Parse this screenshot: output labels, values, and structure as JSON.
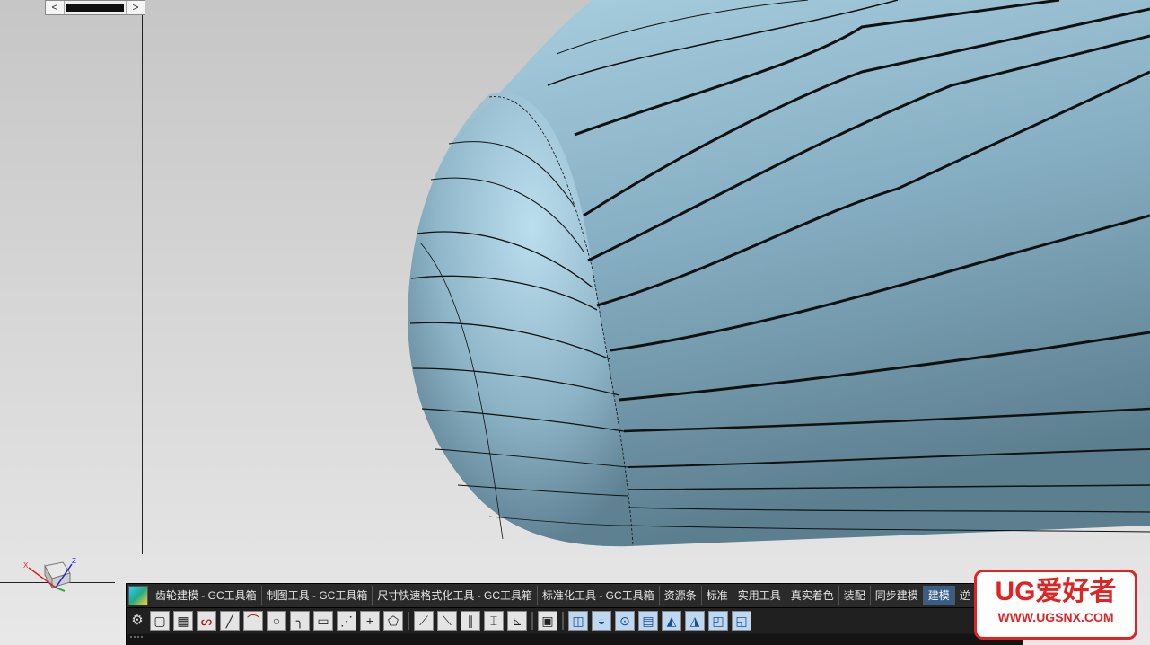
{
  "viewport": {
    "background_top": "#c8c8c8",
    "background_bottom": "#e6e6e6",
    "model_color": "#7fa9bd",
    "triad_labels": {
      "x": "X",
      "y": "Y",
      "z": "Z"
    }
  },
  "scrollbar": {
    "left_arrow": "<",
    "right_arrow": ">"
  },
  "toolbar": {
    "tabs": [
      {
        "label": "齿轮建模 - GC工具箱"
      },
      {
        "label": "制图工具 - GC工具箱"
      },
      {
        "label": "尺寸快速格式化工具 - GC工具箱"
      },
      {
        "label": "标准化工具 - GC工具箱"
      },
      {
        "label": "资源条"
      },
      {
        "label": "标准"
      },
      {
        "label": "实用工具"
      },
      {
        "label": "真实着色"
      },
      {
        "label": "装配"
      },
      {
        "label": "同步建模"
      },
      {
        "label": "建模"
      },
      {
        "label": "逆"
      }
    ],
    "active_tab": "建模",
    "settings_icon": "gear-icon",
    "overflow_label": "»",
    "tools": [
      {
        "name": "rectangle-tool-icon",
        "glyph": "▢"
      },
      {
        "name": "pattern-tool-icon",
        "glyph": "▦"
      },
      {
        "name": "spline-tool-icon",
        "glyph": "ᔕ"
      },
      {
        "name": "line-tool-icon",
        "glyph": "╱"
      },
      {
        "name": "arc-tool-icon",
        "glyph": "⌒"
      },
      {
        "name": "circle-tool-icon",
        "glyph": "○"
      },
      {
        "name": "fillet-tool-icon",
        "glyph": "╮"
      },
      {
        "name": "rectangle2-tool-icon",
        "glyph": "▭"
      },
      {
        "name": "polyline-tool-icon",
        "glyph": "⋰"
      },
      {
        "name": "point-tool-icon",
        "glyph": "+"
      },
      {
        "name": "profile-tool-icon",
        "glyph": "⬠"
      },
      {
        "name": "trim-tool-icon",
        "glyph": "⟋"
      },
      {
        "name": "extend-tool-icon",
        "glyph": "⟍"
      },
      {
        "name": "offset-curve-icon",
        "glyph": "∥"
      },
      {
        "name": "mirror-curve-icon",
        "glyph": "⌶"
      },
      {
        "name": "project-curve-icon",
        "glyph": "⊾"
      },
      {
        "name": "pattern-array-icon",
        "glyph": "▣"
      },
      {
        "name": "extrude-icon",
        "glyph": "◫"
      },
      {
        "name": "revolve-icon",
        "glyph": "◒"
      },
      {
        "name": "hole-icon",
        "glyph": "⊙"
      },
      {
        "name": "block-icon",
        "glyph": "▤"
      },
      {
        "name": "blend-icon",
        "glyph": "◭"
      },
      {
        "name": "chamfer-icon",
        "glyph": "◮"
      },
      {
        "name": "shell-icon",
        "glyph": "◰"
      },
      {
        "name": "surface-icon",
        "glyph": "◱"
      }
    ]
  },
  "watermark": {
    "title": "UG爱好者",
    "url": "WWW.UGSNX.COM"
  }
}
